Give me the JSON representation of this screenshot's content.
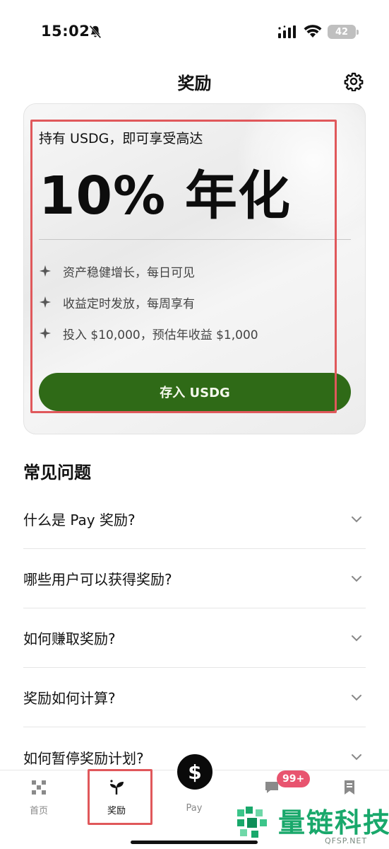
{
  "status_bar": {
    "time": "15:02",
    "battery": "42"
  },
  "header": {
    "title": "奖励"
  },
  "promo": {
    "subtitle": "持有 USDG，即可享受高达",
    "headline": "10% 年化",
    "features": [
      {
        "icon": "sparkle-icon",
        "text": "资产稳健增长，每日可见"
      },
      {
        "icon": "sparkle-icon",
        "text": "收益定时发放，每周享有"
      },
      {
        "icon": "sparkle-icon",
        "text": "投入 $10,000，预估年收益 $1,000"
      }
    ],
    "cta_label": "存入 USDG",
    "cta_color": "#2f6a17"
  },
  "faq": {
    "title": "常见问题",
    "items": [
      {
        "question": "什么是 Pay 奖励?"
      },
      {
        "question": "哪些用户可以获得奖励?"
      },
      {
        "question": "如何赚取奖励?"
      },
      {
        "question": "奖励如何计算?"
      },
      {
        "question": "如何暂停奖励计划?"
      }
    ]
  },
  "tab_bar": {
    "tabs": [
      {
        "label": "首页",
        "icon": "home-grid-icon"
      },
      {
        "label": "奖励",
        "icon": "rewards-sprout-icon"
      },
      {
        "label": "Pay",
        "icon": "dollar-icon"
      },
      {
        "label": "",
        "icon": "chat-icon"
      },
      {
        "label": "",
        "icon": "bookmark-icon"
      }
    ],
    "badge": "99+",
    "pay_glyph": "$"
  },
  "watermark": {
    "text": "量链科技",
    "subtext": "QFSP.NET"
  },
  "colors": {
    "accent_green": "#2f6a17",
    "highlight_red": "#e0585b",
    "badge_pink": "#e8546f"
  }
}
